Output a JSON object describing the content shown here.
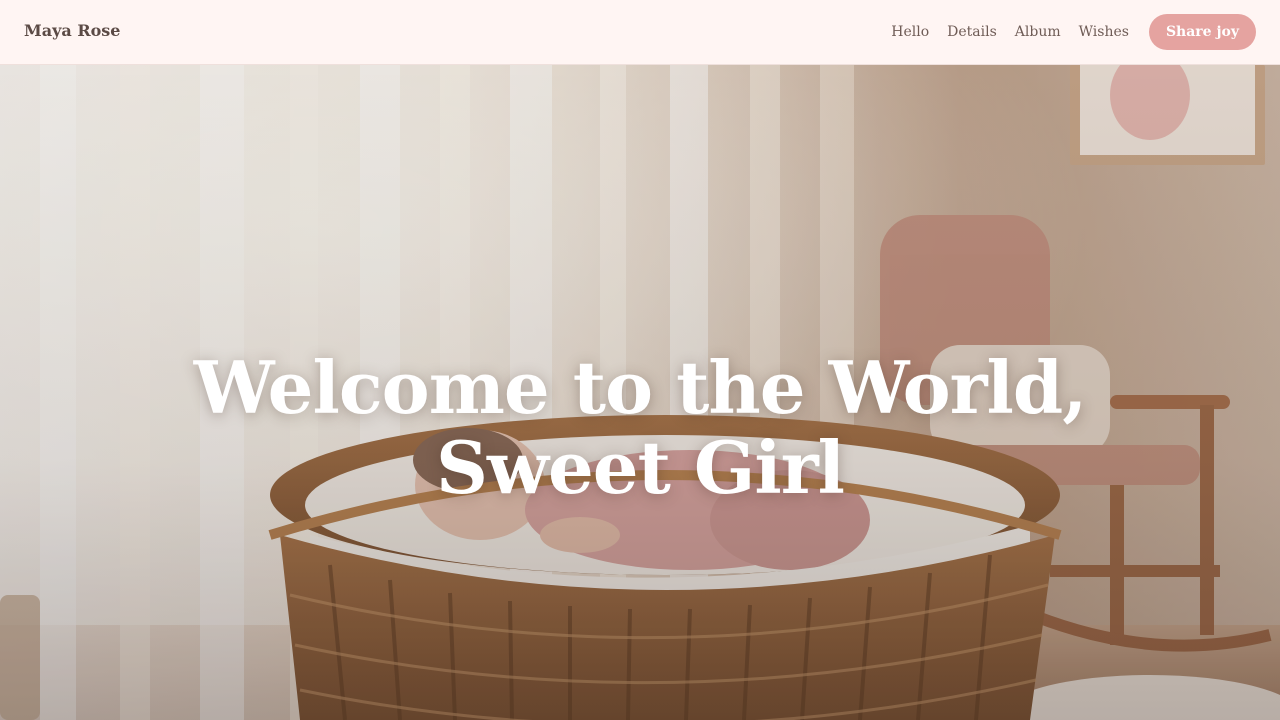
{
  "header": {
    "brand": "Maya Rose",
    "nav": [
      {
        "label": "Hello"
      },
      {
        "label": "Details"
      },
      {
        "label": "Album"
      },
      {
        "label": "Wishes"
      }
    ],
    "cta_label": "Share joy"
  },
  "hero": {
    "title_line1": "Welcome to the World,",
    "title_line2": "Sweet Girl",
    "image": "nursery photo: newborn sleeping in a wicker bassinet, sheer curtains, rocking chair"
  },
  "colors": {
    "header_bg": "#fff5f3",
    "accent": "#e5a3a0",
    "brand_text": "#5b4a45",
    "nav_text": "#6f5c56",
    "hero_title": "#ffffff"
  }
}
